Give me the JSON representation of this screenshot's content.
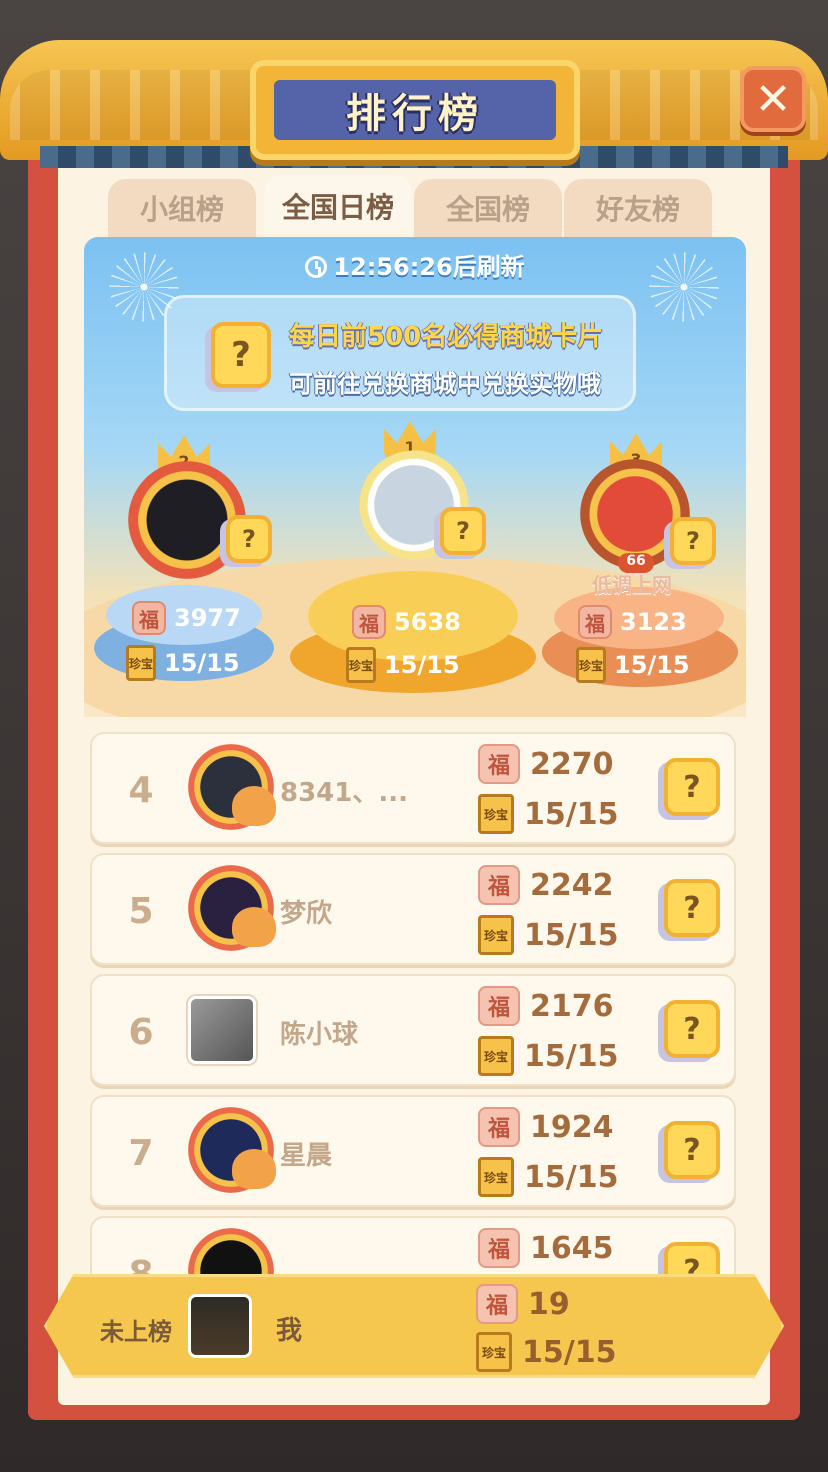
{
  "title": "排行榜",
  "close_label": "✕",
  "tabs": [
    {
      "label": "小组榜",
      "active": false
    },
    {
      "label": "全国日榜",
      "active": true
    },
    {
      "label": "全国榜",
      "active": false
    },
    {
      "label": "好友榜",
      "active": false
    }
  ],
  "refresh_text": "12:56:26后刷新",
  "notice": {
    "line1": "每日前500名必得商城卡片",
    "line2": "可前往兑换商城中兑换实物哦"
  },
  "card_glyph": "?",
  "fu_glyph": "福",
  "book_glyph": "珍宝",
  "podium": [
    {
      "rank": "2",
      "score": "3977",
      "progress": "15/15",
      "color": "#a7cdf0"
    },
    {
      "rank": "1",
      "score": "5638",
      "progress": "15/15",
      "color": "#f7c84e"
    },
    {
      "rank": "3",
      "score": "3123",
      "progress": "15/15",
      "color": "#f6b17a",
      "level": "66",
      "caption": "低调上网"
    }
  ],
  "rows": [
    {
      "rank": "4",
      "name": "8341、...",
      "score": "2270",
      "progress": "15/15"
    },
    {
      "rank": "5",
      "name": "梦欣",
      "score": "2242",
      "progress": "15/15"
    },
    {
      "rank": "6",
      "name": "陈小球",
      "score": "2176",
      "progress": "15/15"
    },
    {
      "rank": "7",
      "name": "星晨",
      "score": "1924",
      "progress": "15/15"
    },
    {
      "rank": "8",
      "name": "",
      "score": "1645",
      "progress": ""
    }
  ],
  "me": {
    "status": "未上榜",
    "name": "我",
    "score": "19",
    "progress": "15/15"
  }
}
